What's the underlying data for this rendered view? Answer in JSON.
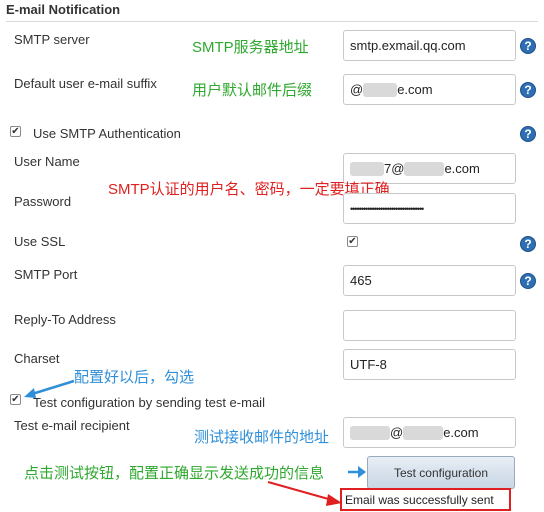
{
  "section": {
    "title": "E-mail Notification"
  },
  "fields": {
    "smtp_server": {
      "label": "SMTP server",
      "value": "smtp.exmail.qq.com"
    },
    "default_suffix": {
      "label": "Default user e-mail suffix",
      "value_prefix": "@",
      "value_suffix": "e.com"
    },
    "use_smtp_auth": {
      "label": "Use SMTP Authentication",
      "checked": true
    },
    "user_name": {
      "label": "User Name",
      "value_part1": "7@",
      "value_part2": "e.com"
    },
    "password": {
      "label": "Password",
      "value": "••••••••••••••••••••••••••••••••••"
    },
    "use_ssl": {
      "label": "Use SSL",
      "checked": true
    },
    "smtp_port": {
      "label": "SMTP Port",
      "value": "465"
    },
    "reply_to": {
      "label": "Reply-To Address",
      "value": ""
    },
    "charset": {
      "label": "Charset",
      "value": "UTF-8"
    },
    "test_config": {
      "label": "Test configuration by sending test e-mail",
      "checked": true
    },
    "test_recipient": {
      "label": "Test e-mail recipient",
      "value_part1": "@",
      "value_part2": "e.com"
    }
  },
  "test_button": {
    "label": "Test configuration"
  },
  "result": {
    "text": "Email was successfully sent"
  },
  "annotations": {
    "smtp_server_note": "SMTP服务器地址",
    "suffix_note": "用户默认邮件后缀",
    "auth_note": "SMTP认证的用户名、密码，一定要填正确",
    "check_note": "配置好以后，勾选",
    "recipient_note": "测试接收邮件的地址",
    "button_note": "点击测试按钮，配置正确显示发送成功的信息"
  },
  "help_icon_glyph": "?",
  "colors": {
    "help": "#2e6fb4",
    "note_green": "#2ea82e",
    "note_red": "#e02020",
    "note_blue": "#2f8fd8"
  }
}
